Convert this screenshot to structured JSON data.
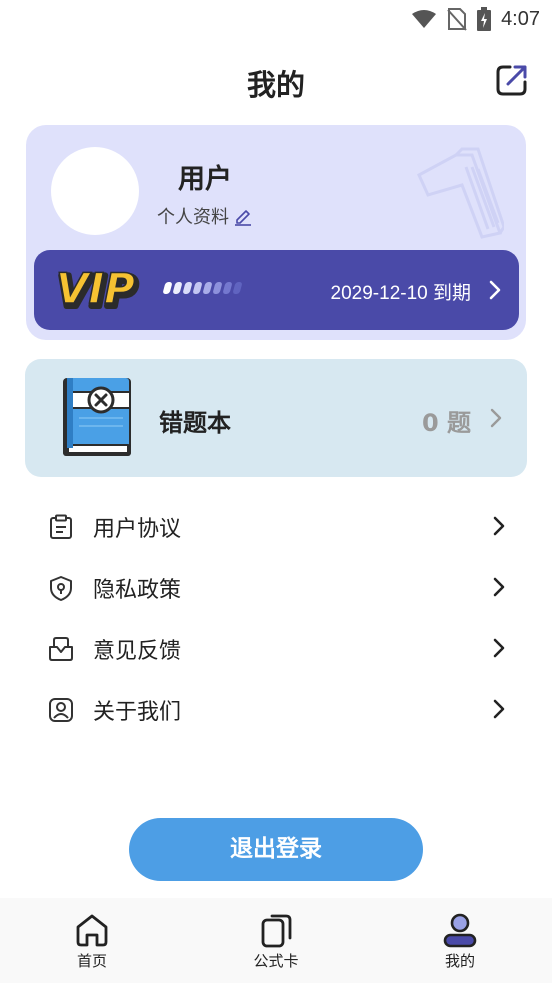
{
  "status_bar": {
    "time": "4:07",
    "icons": [
      "wifi-icon",
      "no-sim-icon",
      "battery-charging-icon"
    ]
  },
  "header": {
    "title": "我的",
    "share_icon": "external-link-icon"
  },
  "profile": {
    "username": "用户",
    "profile_link": "个人资料",
    "vip": {
      "logo_text": "VIP",
      "expiry": "2029-12-10 到期"
    }
  },
  "wrong_book": {
    "title": "错题本",
    "count": "0 题"
  },
  "menu": [
    {
      "label": "用户协议",
      "icon": "clipboard-icon"
    },
    {
      "label": "隐私政策",
      "icon": "shield-icon"
    },
    {
      "label": "意见反馈",
      "icon": "feedback-icon"
    },
    {
      "label": "关于我们",
      "icon": "user-icon"
    }
  ],
  "logout": {
    "label": "退出登录"
  },
  "tabs": [
    {
      "label": "首页",
      "icon": "home-icon"
    },
    {
      "label": "公式卡",
      "icon": "cards-icon"
    },
    {
      "label": "我的",
      "icon": "profile-icon",
      "active": true
    }
  ],
  "colors": {
    "accent": "#4a4aa8",
    "primary_button": "#4d9ee5",
    "profile_card": "#dfe1fb",
    "wrong_card": "#d7e8f1"
  }
}
